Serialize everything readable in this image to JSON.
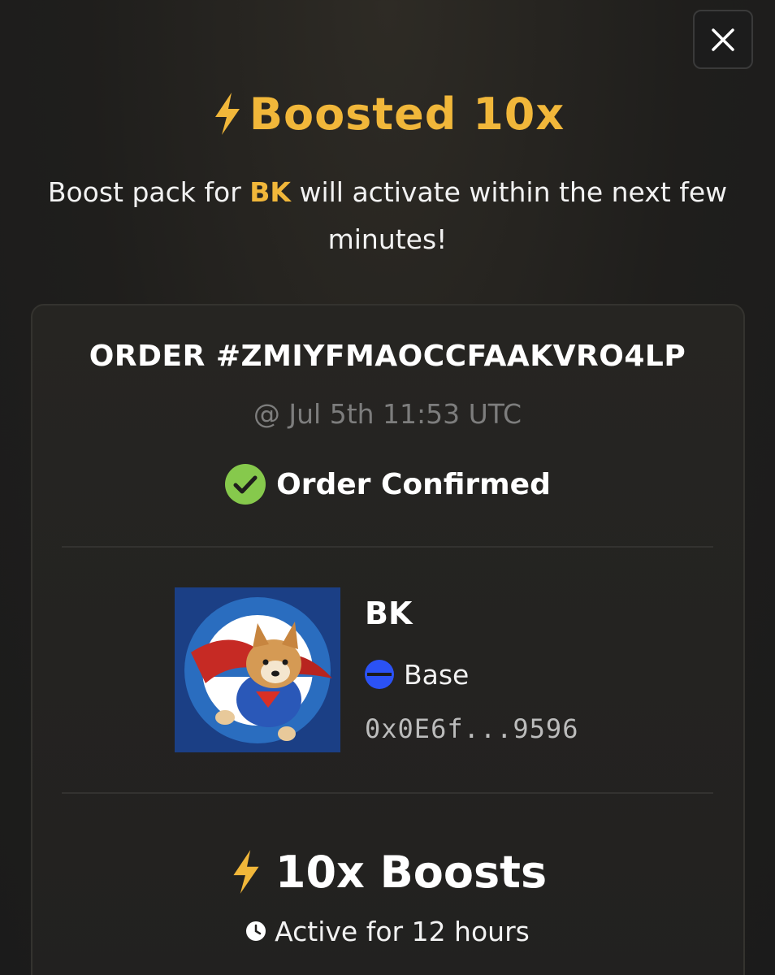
{
  "modal": {
    "close_icon": "close-icon",
    "title": "Boosted 10x",
    "title_icon": "lightning-icon",
    "accent_color": "#f1b73a",
    "subtitle_prefix": "Boost pack for ",
    "subtitle_token": "BK",
    "subtitle_suffix": " will activate within the next few minutes!"
  },
  "order": {
    "id": "ORDER #ZMIYFMAOCCFAAKVRO4LP",
    "time": "@ Jul 5th 11:53 UTC",
    "status": "Order Confirmed",
    "status_icon": "check-circle-icon",
    "status_color": "#86c94c"
  },
  "token": {
    "image": "token-avatar",
    "name": "BK",
    "chain": "Base",
    "chain_icon": "base-chain-icon",
    "chain_color": "#2b52f5",
    "address": "0x0E6f...9596"
  },
  "boost": {
    "label": "10x Boosts",
    "icon": "lightning-icon",
    "duration": "Active for 12 hours",
    "duration_icon": "clock-icon"
  }
}
